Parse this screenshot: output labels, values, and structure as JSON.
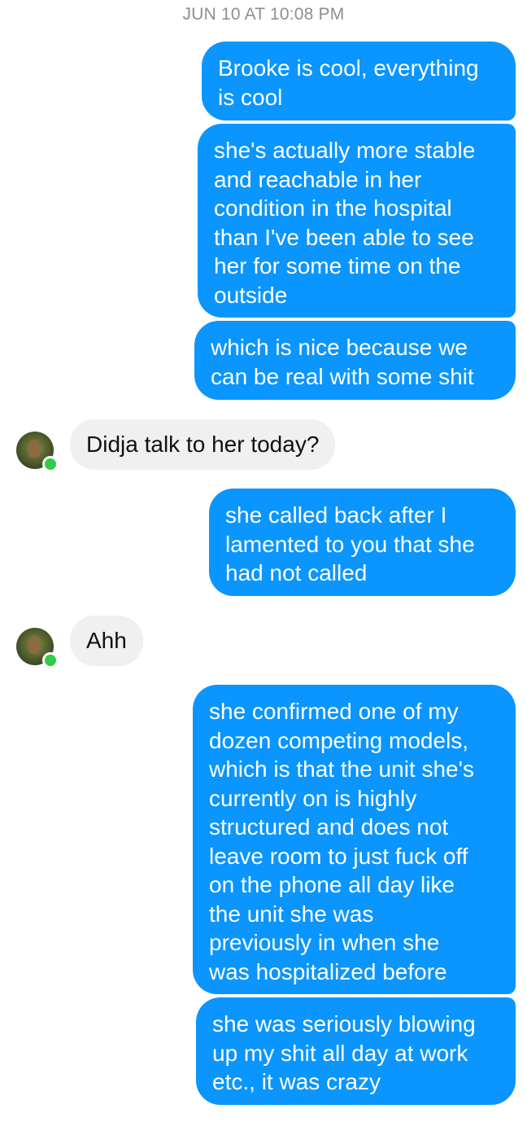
{
  "conversation": {
    "timestamp": "JUN 10 AT 10:08 PM",
    "messages": [
      {
        "sender": "me",
        "text": "Brooke is cool, everything\nis cool"
      },
      {
        "sender": "me",
        "text": "she's actually more stable\nand reachable in her\ncondition in the hospital\nthan I've been able to see\nher for some time on the\noutside"
      },
      {
        "sender": "me",
        "text": "which is nice because we\ncan be real with some shit"
      },
      {
        "sender": "them",
        "text": "Didja talk to her today?"
      },
      {
        "sender": "me",
        "text": "she called back after I\nlamented to you that she\nhad not called"
      },
      {
        "sender": "them",
        "text": "Ahh"
      },
      {
        "sender": "me",
        "text": "she confirmed one of my\ndozen competing models,\nwhich is that the unit she's\ncurrently on is highly\nstructured and does not\nleave room to just fuck off\non the phone all day like\nthe unit she was\npreviously in when she\nwas hospitalized before"
      },
      {
        "sender": "me",
        "text": "she was seriously blowing\nup my shit all day at work\netc., it was crazy"
      }
    ]
  },
  "colors": {
    "sent_bubble": "#0a95ff",
    "received_bubble": "#f0f0f0",
    "online_indicator": "#31cc46",
    "timestamp_text": "#8e8e93"
  },
  "icons": {
    "avatar": "contact-avatar",
    "presence": "online-dot-icon"
  }
}
